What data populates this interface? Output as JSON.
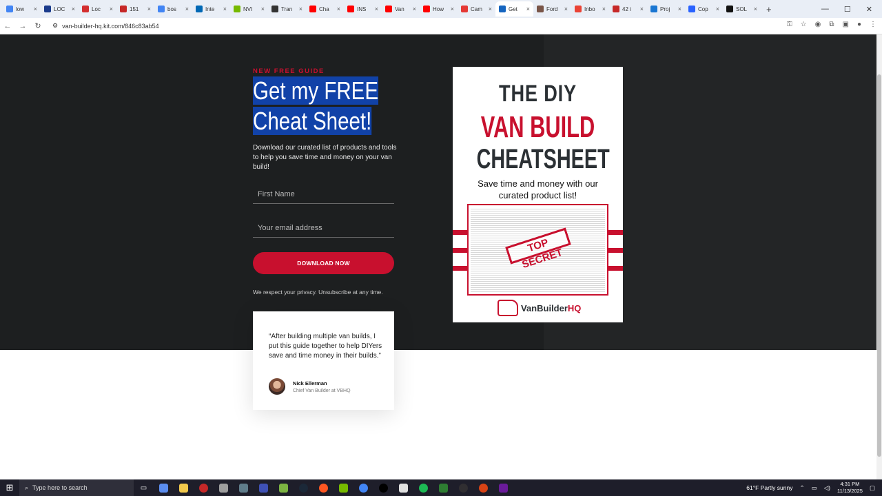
{
  "browser": {
    "tabs": [
      {
        "label": "low",
        "color": "#4285f4"
      },
      {
        "label": "LOC",
        "color": "#1a3b8c"
      },
      {
        "label": "Loc",
        "color": "#d32f2f"
      },
      {
        "label": "151",
        "color": "#c62828"
      },
      {
        "label": "bos",
        "color": "#4285f4"
      },
      {
        "label": "Inte",
        "color": "#0068b5"
      },
      {
        "label": "NVI",
        "color": "#76b900"
      },
      {
        "label": "Tran",
        "color": "#333333"
      },
      {
        "label": "Cha",
        "color": "#ff0000"
      },
      {
        "label": "INS",
        "color": "#ff0000"
      },
      {
        "label": "Van",
        "color": "#ff0000"
      },
      {
        "label": "How",
        "color": "#ff0000"
      },
      {
        "label": "Cam",
        "color": "#e53935"
      },
      {
        "label": "Get",
        "color": "#1565c0",
        "active": true
      },
      {
        "label": "Ford",
        "color": "#795548"
      },
      {
        "label": "Inbo",
        "color": "#ea4335"
      },
      {
        "label": "42 i",
        "color": "#c62828"
      },
      {
        "label": "Proj",
        "color": "#1976d2"
      },
      {
        "label": "Cop",
        "color": "#2962ff"
      },
      {
        "label": "SOL",
        "color": "#111111"
      }
    ],
    "url": "van-builder-hq.kit.com/846c83ab54"
  },
  "hero": {
    "eyebrow": "NEW FREE GUIDE",
    "headline_line1": "Get my FREE",
    "headline_line2": "Cheat Sheet!",
    "description": "Download our curated list of products and tools to help you save time and money on your van build!",
    "first_name_placeholder": "First Name",
    "email_placeholder": "Your email address",
    "button_label": "DOWNLOAD NOW",
    "privacy": "We respect your privacy. Unsubscribe at any time."
  },
  "testimonial": {
    "quote": "“After building multiple van builds, I put this guide together to help DIYers save and time money in their builds.”",
    "name": "Nick Ellerman",
    "title": "Chief Van Builder at VBHQ"
  },
  "cover": {
    "title_line1": "THE DIY",
    "title_line2": "VAN BUILD",
    "title_line3": "CHEATSHEET",
    "subtitle": "Save time and money with our curated product list!",
    "stamp": "TOP SECRET",
    "logo_main": "VanBuilder",
    "logo_accent": "HQ"
  },
  "taskbar": {
    "search_placeholder": "Type here to search",
    "weather": "61°F  Partly sunny",
    "time": "4:31 PM",
    "date": "11/13/2025"
  },
  "colors": {
    "accent": "#c8102e",
    "hero_bg": "#1d1f20",
    "highlight": "#1142a8"
  }
}
